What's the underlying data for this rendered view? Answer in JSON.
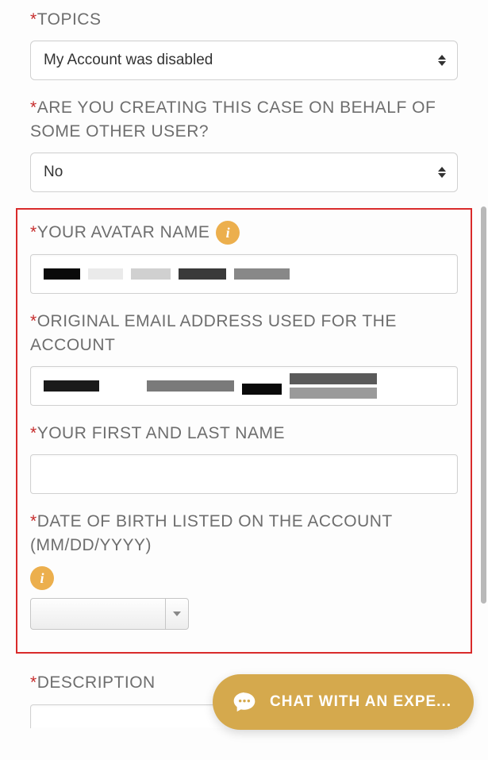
{
  "topics": {
    "label": "TOPICS",
    "value": "My Account was disabled"
  },
  "on_behalf": {
    "label": "ARE YOU CREATING THIS CASE ON BEHALF OF SOME OTHER USER?",
    "value": "No"
  },
  "avatar": {
    "label": "YOUR AVATAR NAME"
  },
  "email": {
    "label": "ORIGINAL EMAIL ADDRESS USED FOR THE ACCOUNT"
  },
  "full_name": {
    "label": "YOUR FIRST AND LAST NAME"
  },
  "dob": {
    "label": "DATE OF BIRTH LISTED ON THE ACCOUNT (MM/DD/YYYY)"
  },
  "description": {
    "label": "DESCRIPTION"
  },
  "chat": {
    "label": "CHAT WITH AN EXPE..."
  },
  "info_glyph": "i"
}
